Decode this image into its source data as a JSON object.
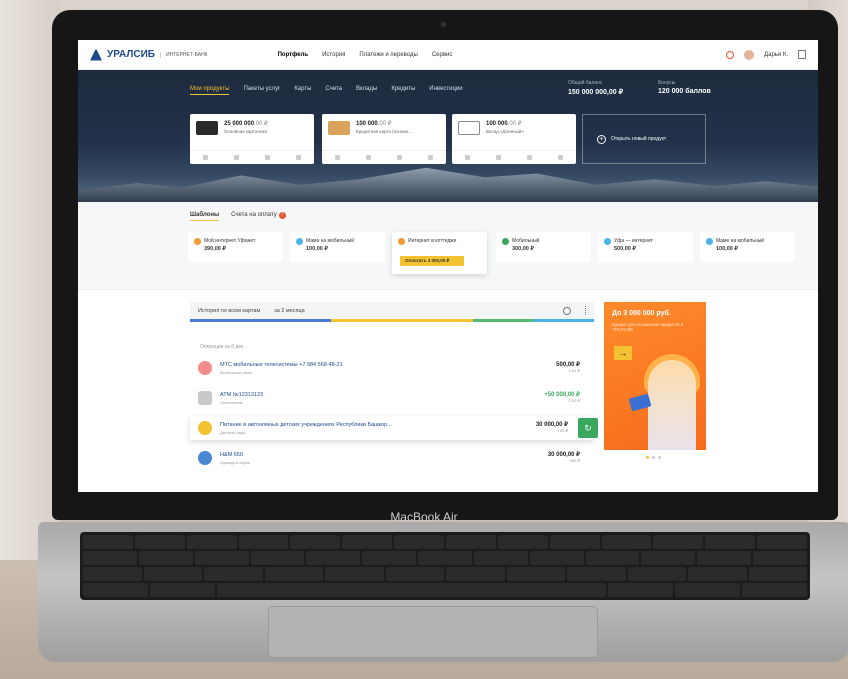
{
  "laptop": {
    "model_label": "MacBook Air"
  },
  "app": {
    "logo_text": "УРАЛСИБ",
    "logo_sub": "ИНТЕРНЕТ-БАНК",
    "topnav": [
      "Портфель",
      "История",
      "Платежи и переводы",
      "Сервис"
    ],
    "user_name": "Дарья К."
  },
  "hero": {
    "tabs": [
      "Мои продукты",
      "Пакеты услуг",
      "Карты",
      "Счета",
      "Вклады",
      "Кредиты",
      "Инвестиции"
    ],
    "balance": {
      "label": "Общий баланс",
      "value": "150 000 000,00 ₽"
    },
    "bonus": {
      "label": "Бонусы",
      "value": "120 000 баллов"
    },
    "products": [
      {
        "amount": "25 000 000",
        "cents": ",00 ₽",
        "name": "Основная карточная"
      },
      {
        "amount": "100 000",
        "cents": ",00 ₽",
        "name": "Кредитная карта (основн..."
      },
      {
        "amount": "100 000",
        "cents": ",00 ₽",
        "name": "Вклад «Длинный»"
      }
    ],
    "open_product_label": "Открыть новый продукт"
  },
  "templates": {
    "tabs": [
      "Шаблоны",
      "Счета на оплату"
    ],
    "alert_count": "!",
    "cards": [
      {
        "name": "Мой интернет Уфанет",
        "amount": "390,00 ₽"
      },
      {
        "name": "Мама на мобильный",
        "amount": "100,00 ₽"
      },
      {
        "name": "Интернет в коттедже",
        "amount": "",
        "pay_label": "Оплатить 3 000,00 ₽"
      },
      {
        "name": "Мобильный",
        "amount": "300,00 ₽"
      },
      {
        "name": "Уфа — интернет",
        "amount": "500,00 ₽"
      },
      {
        "name": "Маме на мобильный",
        "amount": "100,00 ₽"
      }
    ]
  },
  "history": {
    "filters": [
      "История по всем картам",
      "за 2 месяца"
    ],
    "section_title": "Операции за 8 дек",
    "ops": [
      {
        "desc": "МТС мобильные телесистемы +7 984 568-48-21",
        "sub": "Мобильная связь",
        "sum": "500,00 ₽",
        "note": "3.91 ₽"
      },
      {
        "desc": "ATM №12313123",
        "sub": "Пополнение",
        "sum": "+50 000,00 ₽",
        "note": "0,00 ₽"
      },
      {
        "desc": "Питание в автономных детских учреждениях Республики Башкор...",
        "sub": "Детские сады",
        "sum": "30 000,00 ₽",
        "note": "0,00 ₽"
      },
      {
        "desc": "H&M 650",
        "sub": "Одежда и обувь",
        "sum": "30 000,00 ₽",
        "note": "300 ₽"
      }
    ]
  },
  "promo": {
    "title": "До 3 000 000 руб.",
    "text": "Кредит для погашения кредитов в УРАЛСИБ",
    "arrow": "→"
  },
  "colors": {
    "accent": "#f2c230",
    "brand": "#1d4a8f",
    "promo": "#f56b1d",
    "success": "#3aa95f"
  }
}
